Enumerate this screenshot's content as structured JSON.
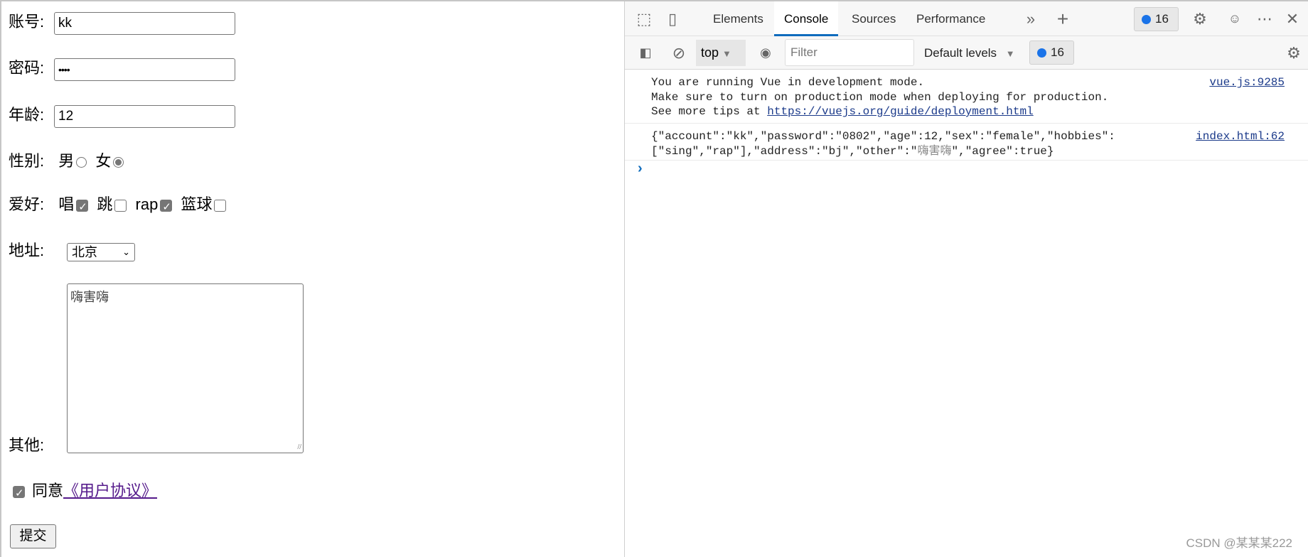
{
  "form": {
    "account": {
      "label": "账号:",
      "value": "kk"
    },
    "password": {
      "label": "密码:",
      "value": "••••"
    },
    "age": {
      "label": "年龄:",
      "value": "12"
    },
    "sex": {
      "label": "性别:",
      "options": [
        {
          "label": "男",
          "checked": false
        },
        {
          "label": "女",
          "checked": true
        }
      ]
    },
    "hobbies": {
      "label": "爱好:",
      "options": [
        {
          "label": "唱",
          "checked": true
        },
        {
          "label": "跳",
          "checked": false
        },
        {
          "label": "rap",
          "checked": true
        },
        {
          "label": "篮球",
          "checked": false
        }
      ]
    },
    "address": {
      "label": "地址:",
      "selected": "北京"
    },
    "other": {
      "label": "其他:",
      "value": "嗨害嗨"
    },
    "agree": {
      "checked": true,
      "label": "同意",
      "link": "《用户协议》 "
    },
    "submit": "提交"
  },
  "devtools": {
    "tabs": [
      "Elements",
      "Console",
      "Sources",
      "Performance"
    ],
    "active_tab": "Console",
    "issues_count": "16",
    "context": "top",
    "filter_placeholder": "Filter",
    "levels": "Default levels",
    "message_count": "16",
    "messages": [
      {
        "lines": [
          "You are running Vue in development mode.",
          "Make sure to turn on production mode when deploying for production.",
          "See more tips at "
        ],
        "url": "https://vuejs.org/guide/deployment.html",
        "source": "vue.js:9285"
      },
      {
        "line1": "{\"account\":\"kk\",\"password\":\"0802\",\"age\":12,\"sex\":\"female\",\"hobbies\":",
        "line2_a": "[\"sing\",\"rap\"],\"address\":\"bj\",\"other\":\"",
        "line2_cjk": "嗨害嗨",
        "line2_b": "\",\"agree\":true}",
        "source": "index.html:62"
      }
    ],
    "prompt": "›"
  },
  "watermark": "CSDN @某某某222"
}
